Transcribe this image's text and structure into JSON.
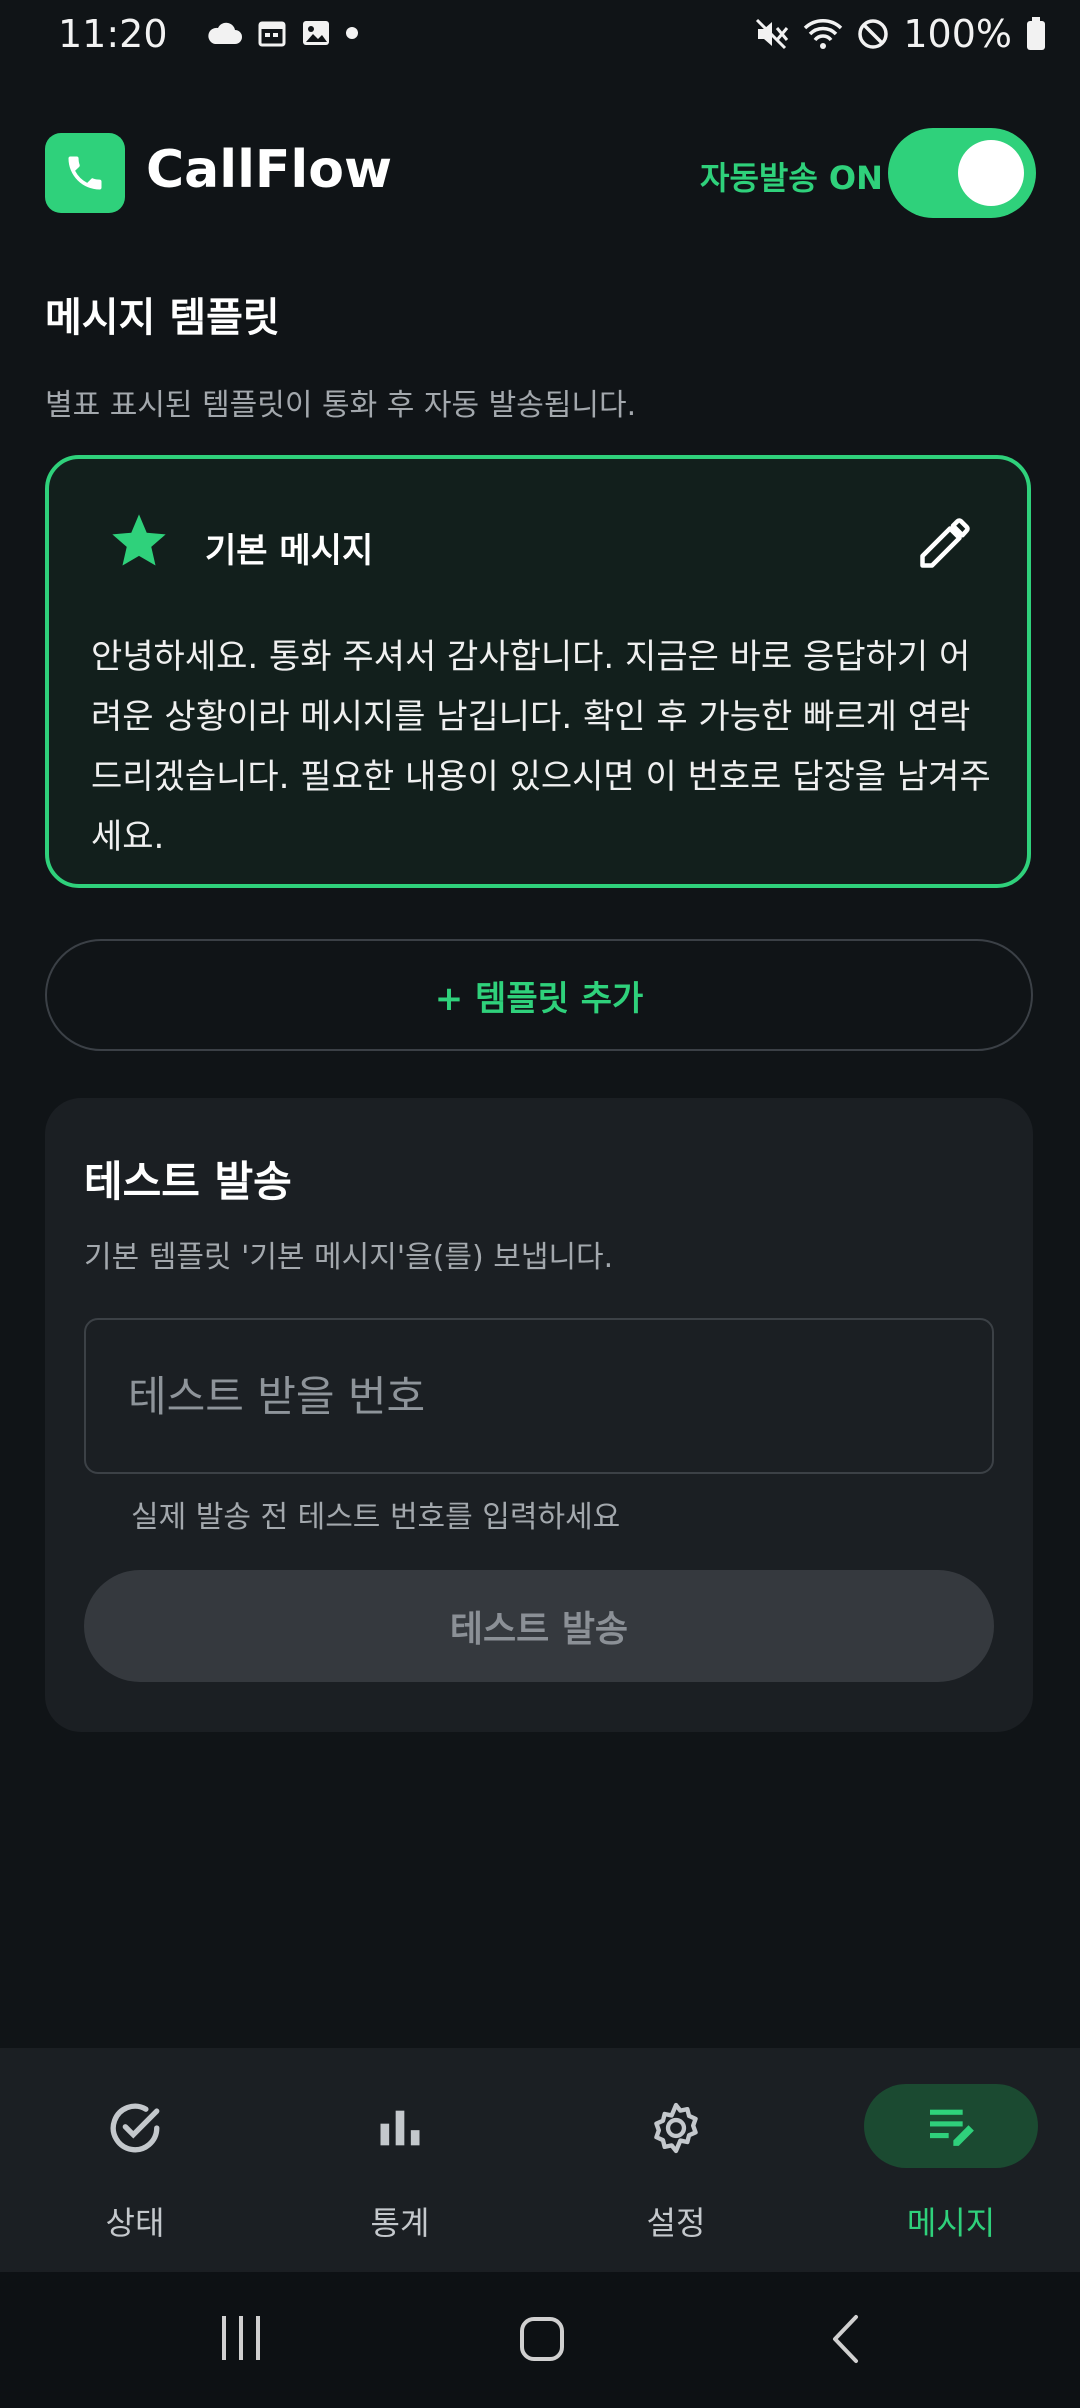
{
  "status_bar": {
    "time": "11:20",
    "battery": "100%",
    "left_icons": [
      "cloud-icon",
      "calendar-icon",
      "image-icon",
      "dot-icon"
    ],
    "right_icons": [
      "mute-icon",
      "wifi-icon",
      "do-not-disturb-icon",
      "battery-icon"
    ]
  },
  "header": {
    "app_name": "CallFlow",
    "auto_send_label": "자동발송 ON",
    "auto_send_enabled": true
  },
  "templates_section": {
    "title": "메시지 템플릿",
    "subtitle": "별표 표시된 템플릿이 통화 후 자동 발송됩니다."
  },
  "template_card": {
    "title": "기본 메시지",
    "starred": true,
    "body": "안녕하세요. 통화 주셔서 감사합니다. 지금은 바로 응답하기 어려운 상황이라 메시지를 남깁니다. 확인 후 가능한 빠르게 연락드리겠습니다. 필요한 내용이 있으시면 이 번호로 답장을 남겨주세요."
  },
  "add_template_label": "+ 템플릿 추가",
  "test_send": {
    "title": "테스트 발송",
    "subtitle": "기본 템플릿 '기본 메시지'을(를) 보냅니다.",
    "input_value": "",
    "input_placeholder": "테스트 받을 번호",
    "hint": "실제 발송 전 테스트 번호를 입력하세요",
    "button_label": "테스트 발송"
  },
  "bottom_nav": {
    "items": [
      {
        "label": "상태",
        "icon": "check-circle-icon"
      },
      {
        "label": "통계",
        "icon": "bar-chart-icon"
      },
      {
        "label": "설정",
        "icon": "gear-icon"
      },
      {
        "label": "메시지",
        "icon": "edit-note-icon"
      }
    ],
    "active_index": 3
  },
  "colors": {
    "background": "#101417",
    "accent": "#2fd17b",
    "panel": "#1b1f23",
    "muted_text": "#a3a8ad"
  }
}
